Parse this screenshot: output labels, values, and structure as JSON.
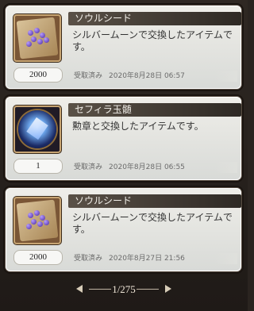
{
  "items": [
    {
      "title": "ソウルシード",
      "description": "シルバームーンで交換したアイテムです。",
      "count": "2000",
      "status": "受取済み",
      "date": "2020年8月28日 06:57",
      "icon": "soul-seed-icon"
    },
    {
      "title": "セフィラ玉髄",
      "description": "勲章と交換したアイテムです。",
      "count": "1",
      "status": "受取済み",
      "date": "2020年8月28日 06:55",
      "icon": "sephira-chalcedony-icon"
    },
    {
      "title": "ソウルシード",
      "description": "シルバームーンで交換したアイテムです。",
      "count": "2000",
      "status": "受取済み",
      "date": "2020年8月27日 21:56",
      "icon": "soul-seed-icon"
    }
  ],
  "pager": {
    "label": "1/275"
  }
}
